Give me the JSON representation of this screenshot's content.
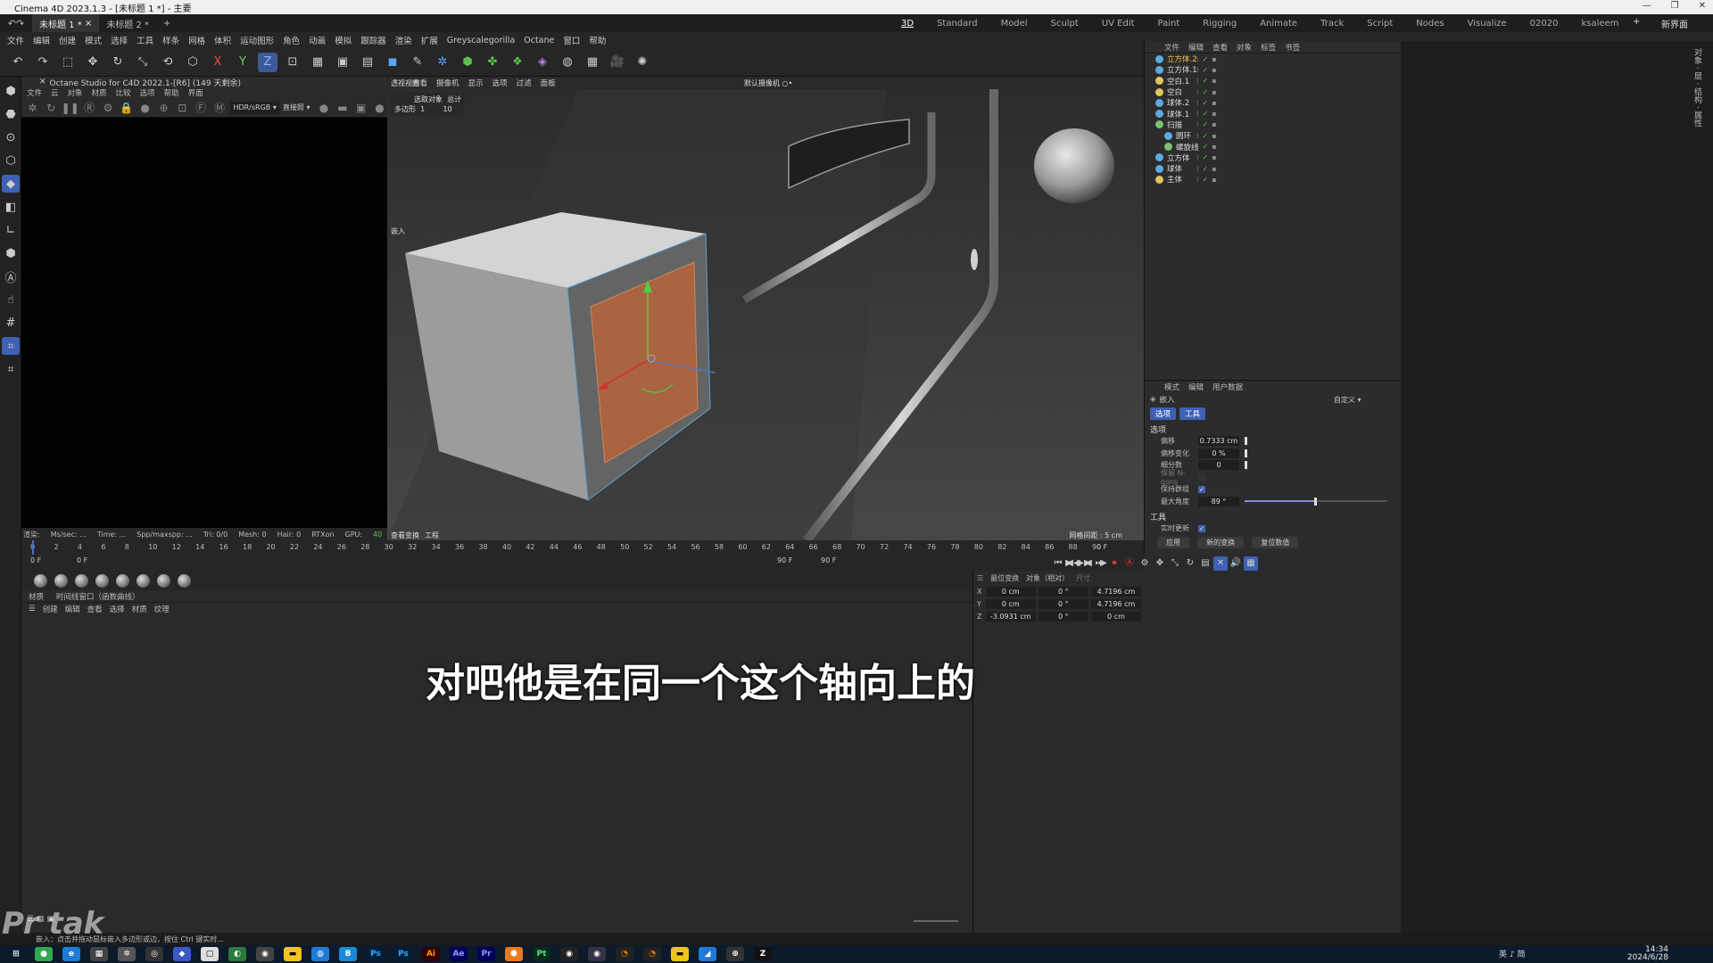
{
  "window": {
    "title": "Cinema 4D 2023.1.3 - [未标题 1 *] - 主要",
    "min": "—",
    "max": "❐",
    "close": "✕"
  },
  "tabs": {
    "doc1": "未标题 1 *",
    "doc1_close": "×",
    "doc2": "未标题 2 *",
    "add": "+"
  },
  "layouts": {
    "items": [
      "3D",
      "Standard",
      "Model",
      "Sculpt",
      "UV Edit",
      "Paint",
      "Rigging",
      "Animate",
      "Track",
      "Script",
      "Nodes",
      "Visualize",
      "02020",
      "ksaleem"
    ],
    "new_label": "新界面"
  },
  "menubar": [
    "文件",
    "编辑",
    "创建",
    "模式",
    "选择",
    "工具",
    "样条",
    "网格",
    "体积",
    "运动图形",
    "角色",
    "动画",
    "模拟",
    "跟踪器",
    "渲染",
    "扩展",
    "Greyscalegorilla",
    "Octane",
    "窗口",
    "帮助"
  ],
  "toolbar": {
    "x_label": "X",
    "y_label": "Y",
    "z_label": "Z"
  },
  "octane": {
    "title": "Octane Studio for C4D 2022.1-[R6] (149 天剩余)",
    "menu": [
      "文件",
      "云",
      "对象",
      "材质",
      "比较",
      "选项",
      "帮助",
      "界面"
    ],
    "mode": "HDR/sRGB",
    "mode2": "直接照",
    "status": [
      "渲染:",
      "Ms/sec: ...",
      "Time: ...",
      "Spp/maxspp: ...",
      "Tri: 0/0",
      "Mesh: 0",
      "Hair: 0",
      "RTXon",
      "GPU:",
      "40"
    ]
  },
  "viewport": {
    "menu": [
      "查看",
      "摄像机",
      "显示",
      "选项",
      "过滤",
      "面板"
    ],
    "label_view": "透视视图",
    "label_camera": "默认摄像机 ○•",
    "info_header": [
      "选取对象",
      "总计"
    ],
    "info_row": [
      "多边形",
      "1",
      "10"
    ],
    "label_embed": "嵌入",
    "foot_left": [
      "查看变换",
      "工程"
    ],
    "foot_right": "网格间距 : 5 cm"
  },
  "objects": {
    "header": [
      "文件",
      "编辑",
      "查看",
      "对象",
      "标签",
      "书签"
    ],
    "items": [
      {
        "name": "立方体.2",
        "icon": "cube-icon",
        "selected": true
      },
      {
        "name": "立方体.1",
        "icon": "cube-icon",
        "selected": false
      },
      {
        "name": "空白.1",
        "icon": "null-icon",
        "selected": false
      },
      {
        "name": "空白",
        "icon": "null-icon",
        "selected": false
      },
      {
        "name": "球体.2",
        "icon": "sphere-icon",
        "selected": false
      },
      {
        "name": "球体.1",
        "icon": "sphere-icon",
        "selected": false
      },
      {
        "name": "扫描",
        "icon": "sweep-icon",
        "selected": false
      },
      {
        "name": "圆环",
        "icon": "circle-icon",
        "selected": false
      },
      {
        "name": "螺旋线",
        "icon": "helix-icon",
        "selected": false
      },
      {
        "name": "立方体",
        "icon": "cube-icon",
        "selected": false
      },
      {
        "name": "球体",
        "icon": "sphere-icon",
        "selected": false
      },
      {
        "name": "主体",
        "icon": "null-icon",
        "selected": false
      }
    ]
  },
  "attributes": {
    "header": [
      "模式",
      "编辑",
      "用户数据"
    ],
    "tool_name": "嵌入",
    "preset": "自定义",
    "tabs": [
      "选项",
      "工具"
    ],
    "section_options": "选项",
    "fields": [
      {
        "label": "偏移",
        "value": "0.7333 cm",
        "level": 0
      },
      {
        "label": "偏移变化",
        "value": "0 %",
        "level": 0
      },
      {
        "label": "细分数",
        "value": "0",
        "level": 0
      }
    ],
    "ngons_label": "保留 N-gons",
    "group_label": "保持群组",
    "max_angle": {
      "label": "最大角度",
      "value": "89 °",
      "level": 0.49
    },
    "section_tool": "工具",
    "realtime_label": "实时更新",
    "buttons": [
      "应用",
      "新的变换",
      "复位数值"
    ]
  },
  "timeline": {
    "ticks": [
      "0",
      "2",
      "4",
      "6",
      "8",
      "10",
      "12",
      "14",
      "16",
      "18",
      "20",
      "22",
      "24",
      "26",
      "28",
      "30",
      "32",
      "34",
      "36",
      "38",
      "40",
      "42",
      "44",
      "46",
      "48",
      "50",
      "52",
      "54",
      "56",
      "58",
      "60",
      "62",
      "64",
      "66",
      "68",
      "70",
      "72",
      "74",
      "76",
      "78",
      "80",
      "82",
      "84",
      "86",
      "88",
      "90"
    ],
    "current_frame": "0 F",
    "start": "0 F",
    "start2": "0 F",
    "end": "90 F",
    "end2": "90 F"
  },
  "materials": {
    "tabs": [
      "材质",
      "时间线窗口（函数曲线）"
    ],
    "menu": [
      "创建",
      "编辑",
      "查看",
      "选择",
      "材质",
      "纹理"
    ]
  },
  "coords": {
    "head": [
      "最位变换",
      "对象（相对）",
      "尺寸"
    ],
    "rows": [
      {
        "axis": "X",
        "pos": "0 cm",
        "rot": "0 °",
        "size": "4.7196 cm"
      },
      {
        "axis": "Y",
        "pos": "0 cm",
        "rot": "0 °",
        "size": "4.7196 cm"
      },
      {
        "axis": "Z",
        "pos": "-3.0931 cm",
        "rot": "0 °",
        "size": "0 cm"
      }
    ]
  },
  "subtitle": "对吧他是在同一个这个轴向上的",
  "statusbar": "嵌入：点击并拖动鼠标嵌入多边形或边，按住 Ctrl 键实时...",
  "watermark": "Pr tak",
  "taskbar": {
    "time": "14:34",
    "date": "2024/6/28",
    "ime": "英 ♪ 简"
  },
  "colors": {
    "accent": "#3e61b5",
    "selected_object": "#f0c84a",
    "selected_face": "#b8643a",
    "check": "#59c24a"
  }
}
